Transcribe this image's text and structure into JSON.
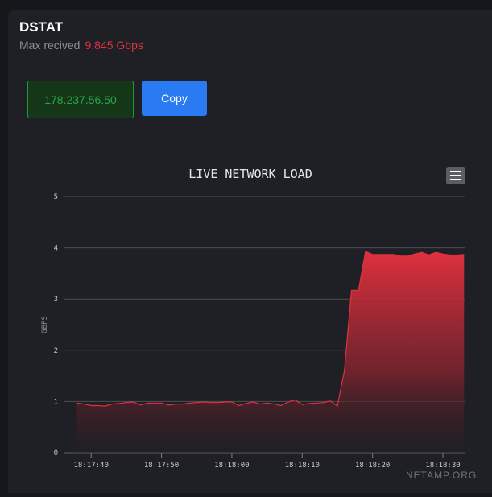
{
  "header": {
    "title": "DSTAT",
    "max_label": "Max recived",
    "max_value": "9.845 Gbps"
  },
  "controls": {
    "ip_value": "178.237.56.50",
    "copy_label": "Copy"
  },
  "chart": {
    "menu_icon": "hamburger-menu-icon",
    "credit": "NETAMP.ORG"
  },
  "colors": {
    "accent_red": "#e0313e",
    "ip_green": "#28a745",
    "button_blue": "#2a7bf2"
  },
  "chart_data": {
    "type": "area",
    "title": "LIVE NETWORK LOAD",
    "ylabel": "GBPS",
    "xlabel": "",
    "ylim": [
      0,
      5
    ],
    "yticks": [
      0,
      1,
      2,
      3,
      4,
      5
    ],
    "xticks": [
      "18:17:40",
      "18:17:50",
      "18:18:00",
      "18:18:10",
      "18:18:20",
      "18:18:30"
    ],
    "xtick_seconds": [
      40,
      50,
      60,
      70,
      80,
      90
    ],
    "grid": true,
    "series": [
      {
        "x": [
          38,
          39,
          40,
          41,
          42,
          43,
          44,
          45,
          46,
          47,
          48,
          49,
          50,
          51,
          52,
          53,
          54,
          55,
          56,
          57,
          58,
          59,
          60,
          61,
          62,
          63,
          64,
          65,
          66,
          67,
          68,
          69,
          70,
          71,
          72,
          73,
          74,
          75,
          76,
          77,
          78,
          79,
          80,
          81,
          82,
          83,
          84,
          85,
          86,
          87,
          88,
          89,
          90,
          91,
          92,
          93
        ],
        "values": [
          0.97,
          0.95,
          0.92,
          0.92,
          0.91,
          0.95,
          0.96,
          0.98,
          0.99,
          0.93,
          0.97,
          0.97,
          0.97,
          0.93,
          0.95,
          0.95,
          0.97,
          0.98,
          0.99,
          0.98,
          0.98,
          0.99,
          0.99,
          0.92,
          0.96,
          0.99,
          0.95,
          0.97,
          0.95,
          0.92,
          0.99,
          1.03,
          0.94,
          0.96,
          0.97,
          0.98,
          1.01,
          0.91,
          1.6,
          3.17,
          3.17,
          3.93,
          3.87,
          3.87,
          3.87,
          3.87,
          3.84,
          3.84,
          3.88,
          3.91,
          3.86,
          3.91,
          3.88,
          3.86,
          3.86,
          3.87
        ]
      }
    ]
  }
}
